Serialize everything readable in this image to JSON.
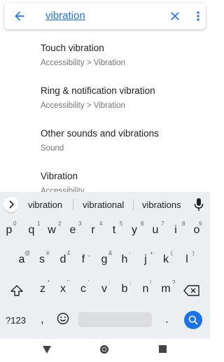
{
  "search": {
    "query": "vibration"
  },
  "results": [
    {
      "title": "Touch vibration",
      "subtitle": "Accessibility > Vibration"
    },
    {
      "title": "Ring & notification vibration",
      "subtitle": "Accessibility > Vibration"
    },
    {
      "title": "Other sounds and vibrations",
      "subtitle": "Sound"
    },
    {
      "title": "Vibration",
      "subtitle": "Accessibility"
    }
  ],
  "keyboard": {
    "suggestions": [
      "vibration",
      "vibrational",
      "vibrations"
    ],
    "row1": {
      "keys": [
        "q",
        "w",
        "e",
        "r",
        "t",
        "y",
        "u",
        "i",
        "o",
        "p"
      ],
      "hints": [
        "1",
        "2",
        "3",
        "4",
        "5",
        "6",
        "7",
        "8",
        "9",
        "0"
      ]
    },
    "row2": {
      "keys": [
        "a",
        "s",
        "d",
        "f",
        "g",
        "h",
        "j",
        "k",
        "l"
      ],
      "hints": [
        "@",
        "#",
        "£",
        "_",
        "&",
        "-",
        "+",
        "(",
        ")"
      ]
    },
    "row3": {
      "keys": [
        "z",
        "x",
        "c",
        "v",
        "b",
        "n",
        "m"
      ],
      "hints": [
        "*",
        "\"",
        "'",
        ":",
        ";",
        "!",
        "?"
      ]
    },
    "symbols_label": "?123",
    "comma": ",",
    "period": "."
  },
  "colors": {
    "accent": "#1a73e8",
    "keyboard_bg": "#eceff1"
  },
  "icons": [
    "back-arrow-icon",
    "close-icon",
    "more-vert-icon",
    "chevron-right-icon",
    "mic-icon",
    "shift-icon",
    "backspace-icon",
    "emoji-icon",
    "search-icon",
    "nav-back-icon",
    "nav-home-icon",
    "nav-recents-icon"
  ]
}
